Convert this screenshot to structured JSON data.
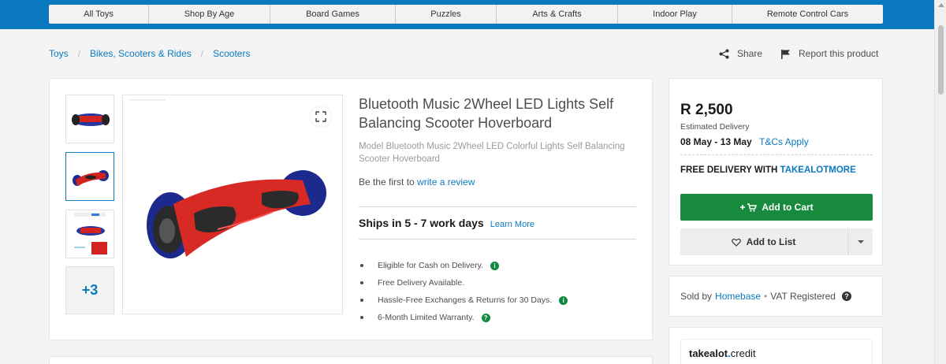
{
  "nav": {
    "categories": [
      "All Toys",
      "Shop By Age",
      "Board Games",
      "Puzzles",
      "Arts & Crafts",
      "Indoor Play",
      "Remote Control Cars"
    ]
  },
  "breadcrumb": [
    "Toys",
    "Bikes, Scooters & Rides",
    "Scooters"
  ],
  "actions": {
    "share": "Share",
    "report": "Report this product"
  },
  "gallery": {
    "more_label": "+3"
  },
  "product": {
    "title": "Bluetooth Music 2Wheel LED Lights Self Balancing Scooter Hoverboard",
    "subtitle": "Model Bluetooth Music 2Wheel LED Colorful Lights Self Balancing Scooter Hoverboard",
    "review_prefix": "Be the first to",
    "review_link": "write a review",
    "ships": "Ships in 5 - 7 work days",
    "learn_more": "Learn More",
    "features": [
      "Eligible for Cash on Delivery.",
      "Free Delivery Available.",
      "Hassle-Free Exchanges & Returns for 30 Days.",
      "6-Month Limited Warranty."
    ]
  },
  "buybox": {
    "price": "R 2,500",
    "estimated_label": "Estimated Delivery",
    "dates": "08 May - 13 May",
    "tcs": "T&Cs Apply",
    "free_delivery_prefix": "FREE DELIVERY WITH",
    "free_delivery_brand": "TAKEALOTMORE",
    "add_to_cart": "Add to Cart",
    "add_to_list": "Add to List"
  },
  "seller": {
    "prefix": "Sold by",
    "name": "Homebase",
    "separator": "•",
    "vat": "VAT Registered"
  },
  "credit": {
    "brand_a": "takealot",
    "brand_dot": ".",
    "brand_b": "credit"
  },
  "colors": {
    "brand_blue": "#0b79bf",
    "cart_green": "#178a3e"
  }
}
